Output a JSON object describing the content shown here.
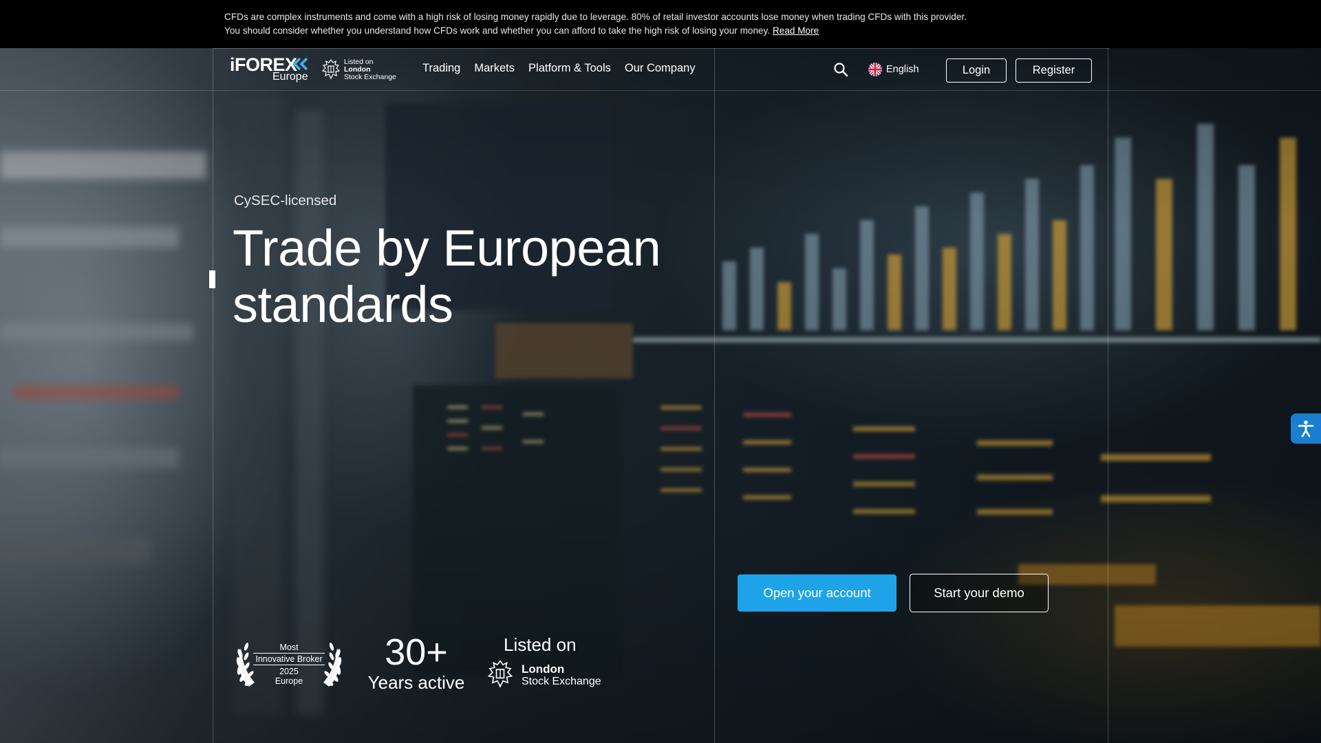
{
  "risk_banner": {
    "line1": "CFDs are complex instruments and come with a high risk of losing money rapidly due to leverage. 80% of retail investor accounts lose money when trading CFDs with this provider.",
    "line2": "You should consider whether you understand how CFDs work and whether you can afford to take the high risk of losing your money.",
    "read_more": "Read More"
  },
  "header": {
    "logo_text": "iFOREX",
    "logo_sub": "Europe",
    "listing": {
      "line1": "Listed on",
      "line2": "London",
      "line3": "Stock Exchange"
    },
    "nav": [
      "Trading",
      "Markets",
      "Platform & Tools",
      "Our Company"
    ],
    "language": "English",
    "login_label": "Login",
    "register_label": "Register"
  },
  "hero": {
    "eyebrow": "CySEC-licensed",
    "title_line1": "Trade by European",
    "title_line2": "standards",
    "primary_cta": "Open your account",
    "secondary_cta": "Start your demo"
  },
  "badges": {
    "award": {
      "line1": "Most",
      "line2": "Innovative Broker",
      "line3": "2025",
      "line4": "Europe"
    },
    "years": {
      "number": "30+",
      "label": "Years active"
    },
    "lse": {
      "listed": "Listed on",
      "line1": "London",
      "line2": "Stock Exchange"
    }
  },
  "colors": {
    "accent": "#1fa3e8",
    "banner_bg": "#000000",
    "accessibility": "#1a7fd0"
  },
  "icons": {
    "search": "search-icon",
    "language": "uk-flag-icon",
    "accessibility": "accessibility-icon",
    "award": "laurel-wreath-icon",
    "lse": "lse-crest-icon"
  }
}
